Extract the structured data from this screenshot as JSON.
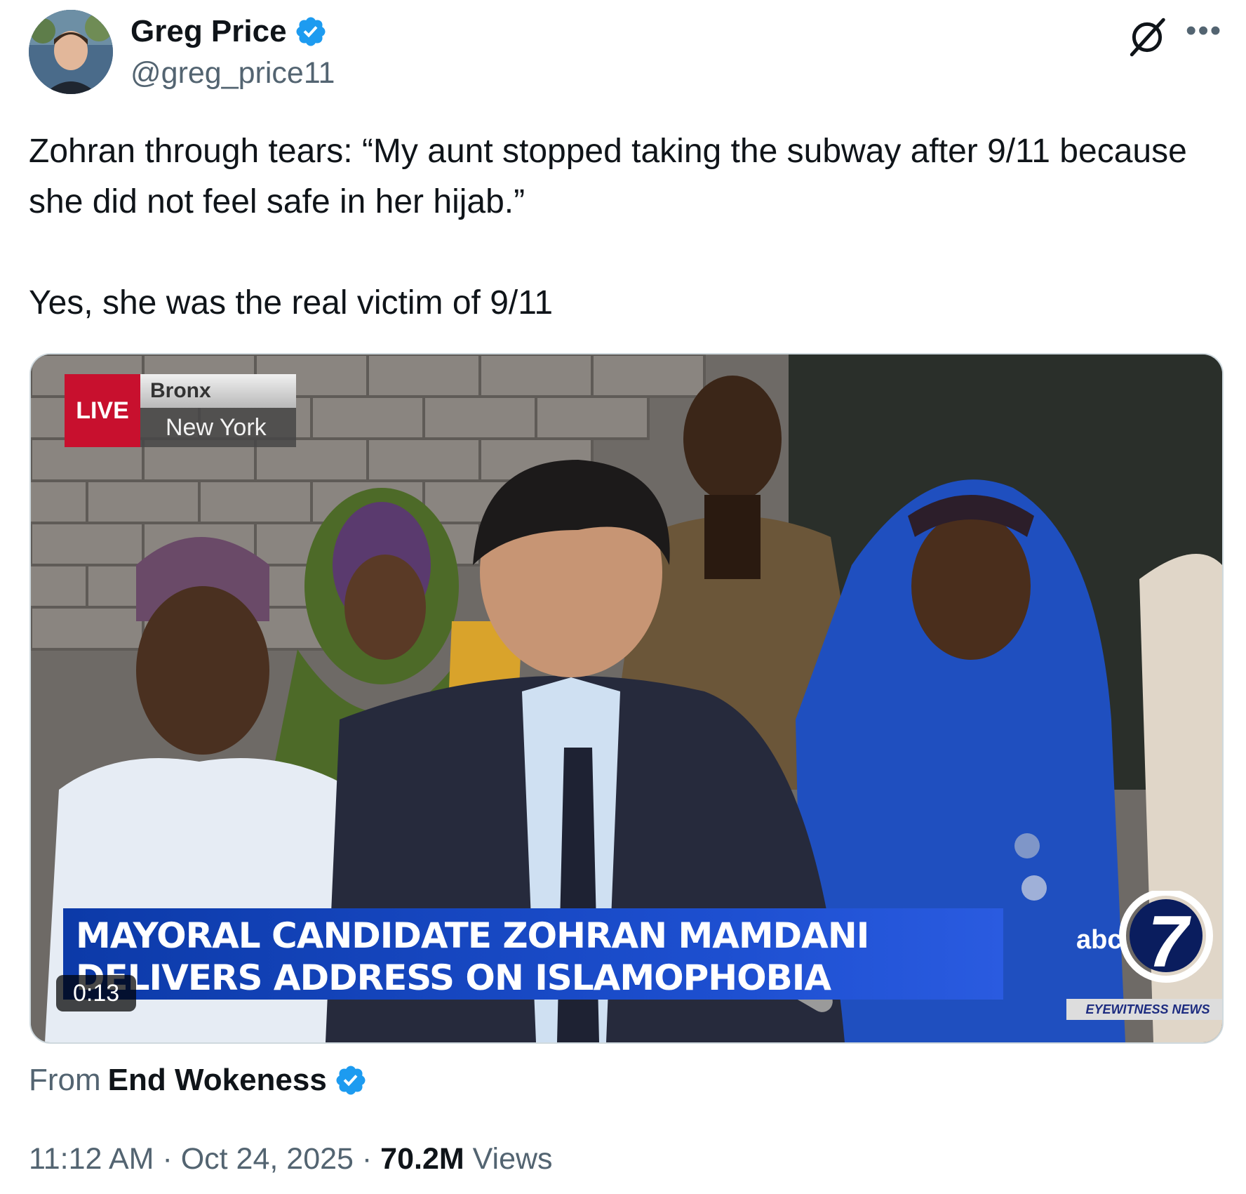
{
  "author": {
    "name": "Greg Price",
    "handle": "@greg_price11",
    "verified": true,
    "verified_color": "#1d9bf0"
  },
  "header_icons": [
    "grok-icon",
    "more-options-icon"
  ],
  "tweet": {
    "paragraph1": "Zohran through tears: “My aunt stopped taking the subway after 9/11 because she did not feel safe in her hijab.”",
    "paragraph2": "Yes, she was the real victim of 9/11"
  },
  "video": {
    "live_label": "LIVE",
    "location_top": "Bronx",
    "location_bottom": "New York",
    "lower_third_line1": "MAYORAL CANDIDATE ZOHRAN MAMDANI",
    "lower_third_line2": "DELIVERS ADDRESS ON ISLAMOPHOBIA",
    "network_label": "abc",
    "channel_number": "7",
    "network_tagline": "EYEWITNESS NEWS",
    "duration": "0:13"
  },
  "source": {
    "from_label": "From",
    "name": "End Wokeness"
  },
  "meta": {
    "time": "11:12 AM",
    "sep1": " · ",
    "date": "Oct 24, 2025",
    "sep2": " · ",
    "views_count": "70.2M",
    "views_label": " Views"
  }
}
